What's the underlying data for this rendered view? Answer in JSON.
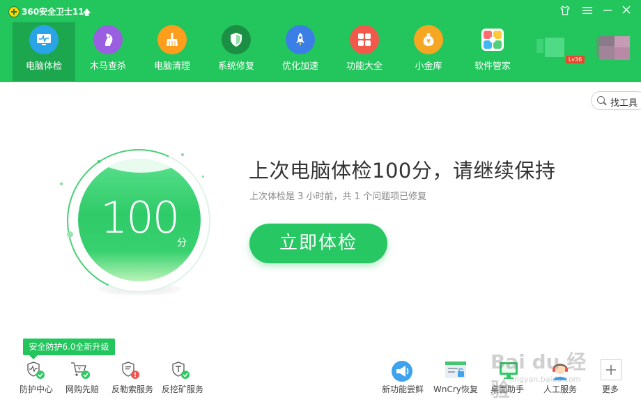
{
  "app": {
    "title": "360安全卫士11",
    "upgrade_icon": "up-arrow-icon"
  },
  "window_controls": {
    "skin_icon": "shirt-icon",
    "menu_icon": "menu-icon",
    "minimize_icon": "minimize-icon",
    "close_icon": "close-icon"
  },
  "nav": {
    "items": [
      {
        "label": "电脑体检",
        "icon": "monitor-icon",
        "active": true,
        "color": "#2fa7e6"
      },
      {
        "label": "木马查杀",
        "icon": "horse-icon",
        "active": false,
        "color": "#9b5ce0"
      },
      {
        "label": "电脑清理",
        "icon": "broom-icon",
        "active": false,
        "color": "#ff9c1a"
      },
      {
        "label": "系统修复",
        "icon": "shield-icon",
        "active": false,
        "color": "#1f9e4a"
      },
      {
        "label": "优化加速",
        "icon": "rocket-icon",
        "active": false,
        "color": "#3a7fe8"
      },
      {
        "label": "功能大全",
        "icon": "grid-icon",
        "active": false,
        "color": "#f2594b"
      },
      {
        "label": "小金库",
        "icon": "money-bag-icon",
        "active": false,
        "color": "#f5a623"
      },
      {
        "label": "软件管家",
        "icon": "flower-icon",
        "active": false,
        "color": "#ffffff"
      }
    ]
  },
  "user": {
    "level": "Lv36"
  },
  "tool_search": {
    "label": "找工具"
  },
  "score": {
    "value": "100",
    "unit": "分"
  },
  "main": {
    "headline": "上次电脑体检100分，请继续保持",
    "subline": "上次体检是 3 小时前，共 1 个问题项已修复",
    "check_button": "立即体检"
  },
  "bottom": {
    "promo": "安全防护6.0全新升级",
    "left_items": [
      {
        "label": "防护中心",
        "icon": "protection-center-icon"
      },
      {
        "label": "网购先赔",
        "icon": "shopping-cart-icon"
      },
      {
        "label": "反勒索服务",
        "icon": "anti-ransom-icon"
      },
      {
        "label": "反挖矿服务",
        "icon": "anti-mining-icon"
      }
    ],
    "right_items": [
      {
        "label": "新功能尝鲜",
        "icon": "megaphone-icon"
      },
      {
        "label": "WnCry恢复",
        "icon": "wncry-restore-icon"
      },
      {
        "label": "桌面助手",
        "icon": "desktop-assistant-icon"
      },
      {
        "label": "人工服务",
        "icon": "customer-service-icon"
      },
      {
        "label": "更多",
        "icon": "plus-icon"
      }
    ]
  },
  "watermark": {
    "main": "Bai du 经验",
    "url": "jingyan.baidu.com"
  },
  "colors": {
    "brand_green": "#23c55d",
    "active_tab": "#1ca74f",
    "button_green": "#27c863"
  }
}
